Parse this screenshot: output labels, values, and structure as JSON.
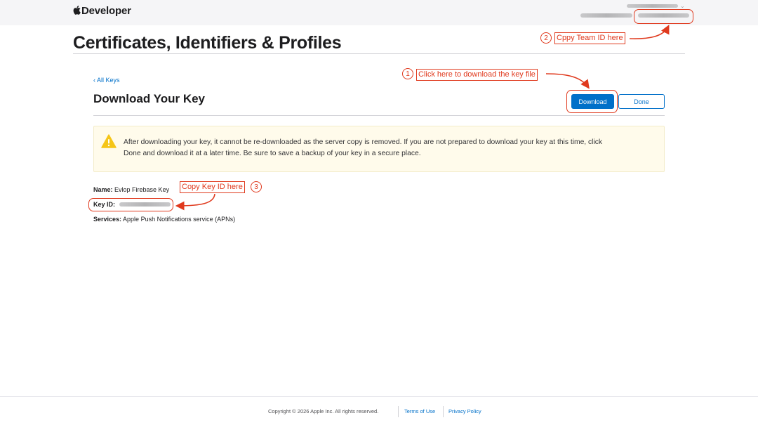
{
  "header": {
    "brand": "Developer",
    "brand_icon": "apple-logo-icon"
  },
  "page_title": "Certificates, Identifiers & Profiles",
  "breadcrumb": {
    "back_link": "‹ All Keys"
  },
  "section": {
    "title": "Download Your Key",
    "download_label": "Download",
    "done_label": "Done"
  },
  "warning": {
    "icon": "warning-icon",
    "text": "After downloading your key, it cannot be re-downloaded as the server copy is removed. If you are not prepared to download your key at this time, click Done and download it at a later time. Be sure to save a backup of your key in a secure place."
  },
  "details": {
    "name_label": "Name:",
    "name_value": "Evlop Firebase Key",
    "keyid_label": "Key ID:",
    "services_label": "Services:",
    "services_value": "Apple Push Notifications service (APNs)"
  },
  "annotations": [
    {
      "number": "1",
      "text": "Click here to download the key file"
    },
    {
      "number": "2",
      "text": "Cppy Team ID here"
    },
    {
      "number": "3",
      "text": "Copy Key ID here"
    }
  ],
  "footer": {
    "copyright": "Copyright © 2026 Apple Inc. All rights reserved.",
    "terms": "Terms of Use",
    "privacy": "Privacy Policy"
  },
  "colors": {
    "accent": "#0070c9",
    "annotation": "#e03a1e",
    "warning_bg": "#fffbeb",
    "warning_icon": "#f5c518"
  }
}
